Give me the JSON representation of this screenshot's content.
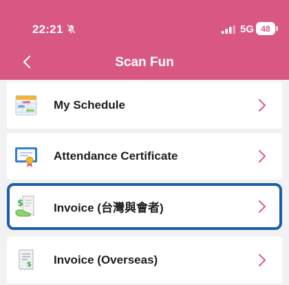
{
  "status_bar": {
    "time": "22:21",
    "network": "5G",
    "battery": "48"
  },
  "nav": {
    "title": "Scan Fun"
  },
  "menu": [
    {
      "label": "My Schedule",
      "icon": "schedule-icon",
      "selected": false
    },
    {
      "label": "Attendance Certificate",
      "icon": "certificate-icon",
      "selected": false
    },
    {
      "label": "Invoice (台灣與會者)",
      "icon": "invoice-receipt-icon",
      "selected": true
    },
    {
      "label": "Invoice (Overseas)",
      "icon": "receipt-icon",
      "selected": false
    }
  ],
  "colors": {
    "header": "#d95883",
    "chevron": "#d95883",
    "highlight": "#1b5ea8"
  }
}
